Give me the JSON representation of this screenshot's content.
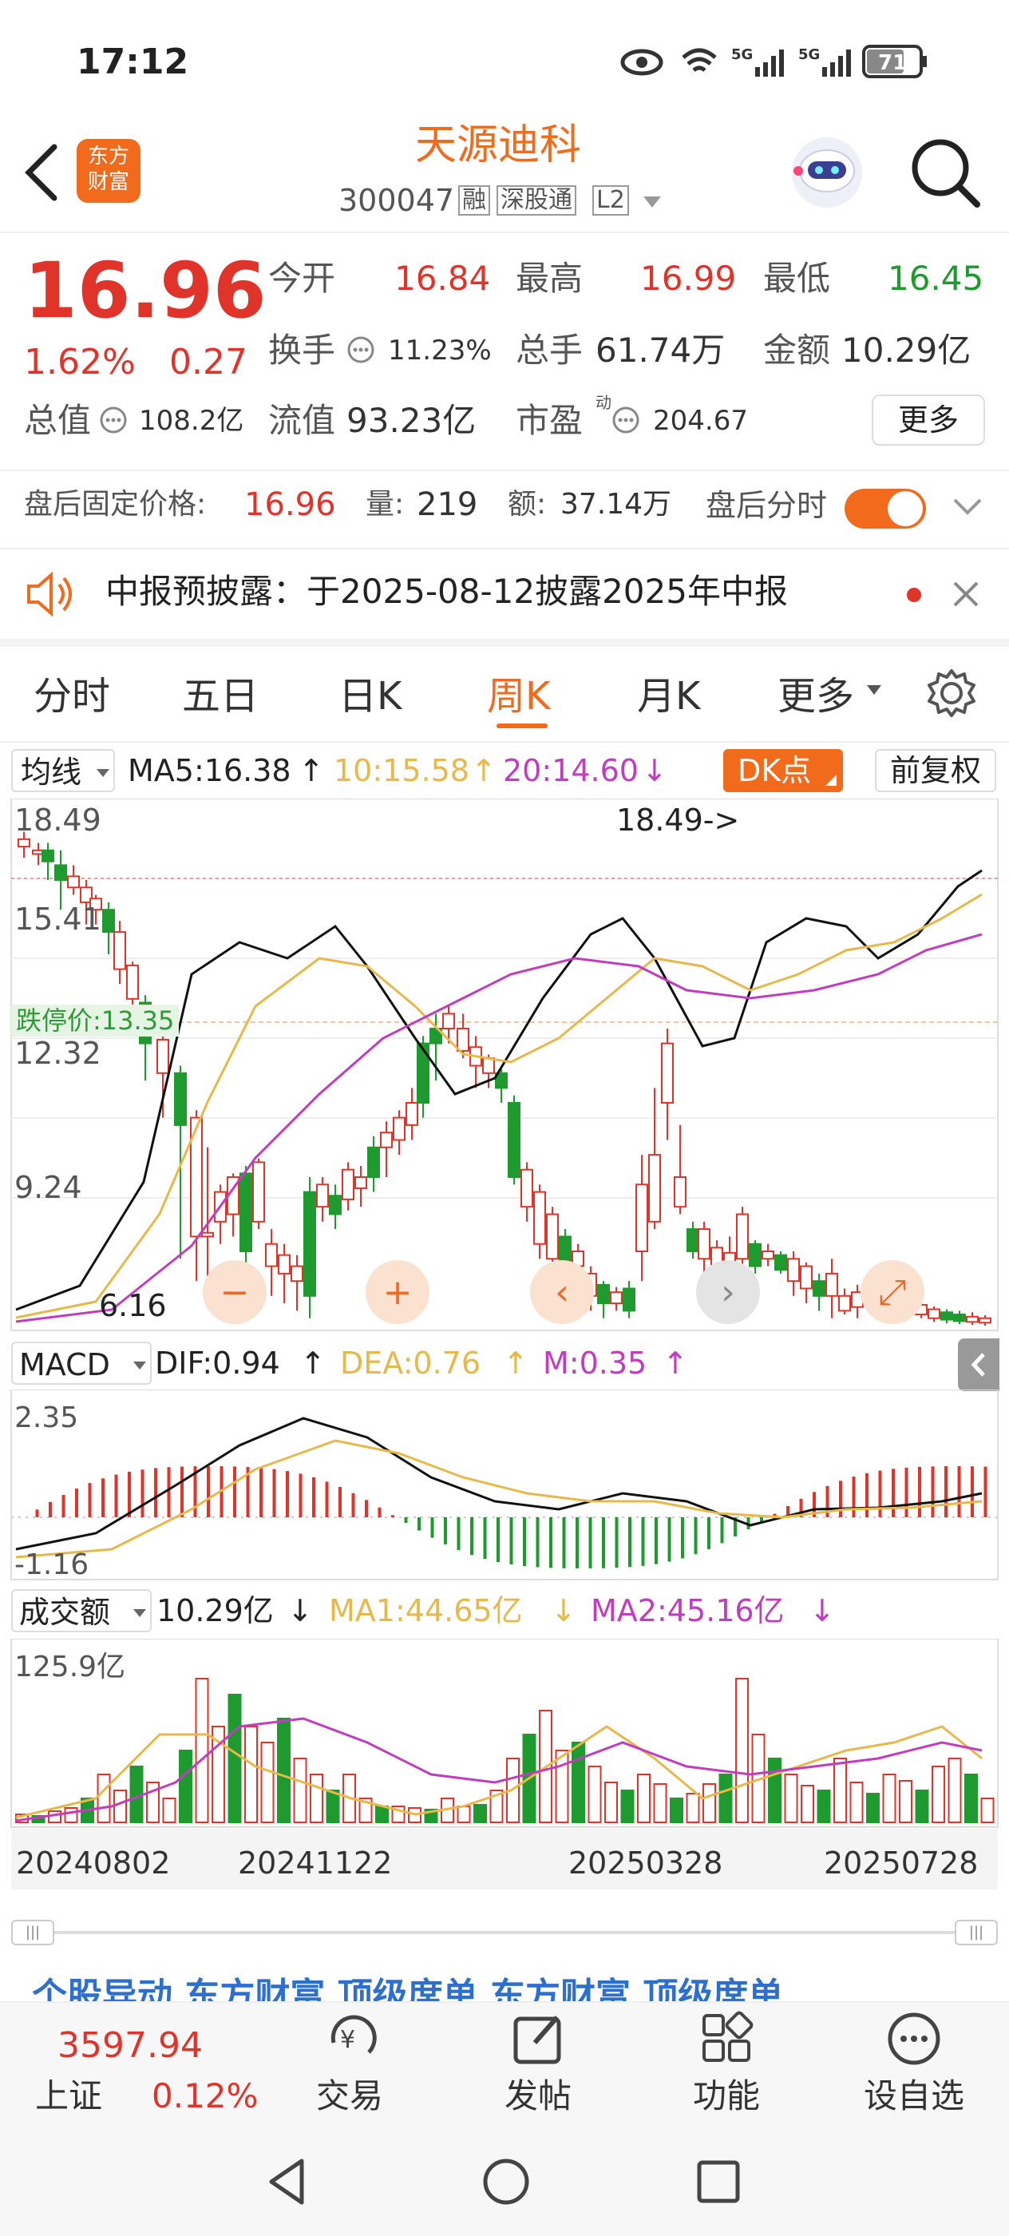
{
  "status": {
    "time": "17:12",
    "network": "5G",
    "network2": "5G",
    "battery": "71"
  },
  "header": {
    "title": "天源迪科",
    "code": "300047",
    "tags": [
      "融",
      "深股通",
      "L2"
    ],
    "back_icon": "chevron-left-icon",
    "logo_line1": "东方",
    "logo_line2": "财富"
  },
  "quote": {
    "price": "16.96",
    "pct": "1.62%",
    "change": "0.27",
    "open_label": "今开",
    "open": "16.84",
    "high_label": "最高",
    "high": "16.99",
    "low_label": "最低",
    "low": "16.45",
    "turnover_label": "换手",
    "turnover": "11.23%",
    "vol_label": "总手",
    "vol": "61.74万",
    "amount_label": "金额",
    "amount": "10.29亿",
    "cap_label": "总值",
    "cap": "108.2亿",
    "float_label": "流值",
    "float": "93.23亿",
    "pe_label": "市盈",
    "pe_sup": "动",
    "pe": "204.67",
    "more": "更多"
  },
  "after": {
    "price_label": "盘后固定价格:",
    "price": "16.96",
    "vol_label": "量:",
    "vol": "219",
    "amt_label": "额:",
    "amt": "37.14万",
    "toggle_label": "盘后分时",
    "toggle_on": true
  },
  "notice": {
    "text": "中报预披露：于2025-08-12披露2025年中报"
  },
  "tabs": {
    "items": [
      "分时",
      "五日",
      "日K",
      "周K",
      "月K",
      "更多"
    ],
    "active": 3
  },
  "ma": {
    "selector": "均线",
    "ma5": "MA5:16.38",
    "ma10": "10:15.58",
    "ma20": "20:14.60",
    "dk": "DK点",
    "fq": "前复权"
  },
  "kline": {
    "y_labels": [
      "18.49",
      "15.41",
      "12.32",
      "9.24"
    ],
    "max_note": "18.49->",
    "min_note": "6.16",
    "limit_label": "跌停价:13.35",
    "bottom_label": "6.16"
  },
  "macd": {
    "selector": "MACD",
    "dif": "DIF:0.94",
    "dea": "DEA:0.76",
    "m": "M:0.35",
    "y_top": "2.35",
    "y_bottom": "-1.16"
  },
  "volume": {
    "selector": "成交额",
    "val": "10.29亿",
    "ma1": "MA1:44.65亿",
    "ma2": "MA2:45.16亿",
    "y_top": "125.9亿"
  },
  "dates": [
    "20240802",
    "20241122",
    "20250328",
    "20250728"
  ],
  "news": {
    "text": "个股异动 东方财富 顶级席单 东方财富 顶级席单"
  },
  "bottom": {
    "index_val": "3597.94",
    "index_name": "上证",
    "index_pct": "0.12%",
    "items": [
      "交易",
      "发帖",
      "功能",
      "设自选"
    ]
  },
  "colors": {
    "up": "#e0342b",
    "down": "#1f9a2e",
    "ma10": "#e7b84a",
    "ma20": "#c23cbf",
    "accent": "#f26a1b"
  }
}
